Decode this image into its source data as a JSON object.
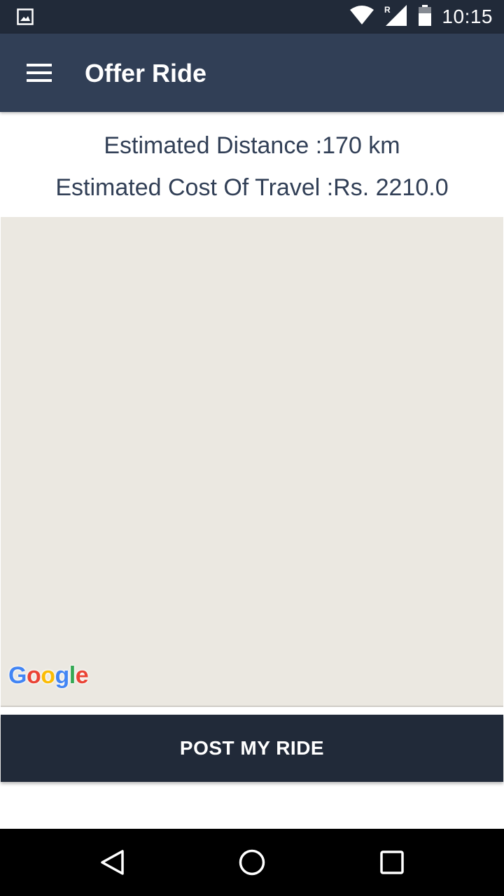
{
  "status_bar": {
    "time": "10:15",
    "icons": [
      "image-notification-icon",
      "wifi-icon",
      "signal-roaming-icon",
      "battery-icon"
    ],
    "roaming_indicator": "R"
  },
  "app_bar": {
    "title": "Offer Ride",
    "menu_icon": "hamburger-menu-icon",
    "background": "#313f56"
  },
  "estimate": {
    "distance_text": "Estimated Distance :170 km",
    "cost_text": "Estimated Cost Of Travel :Rs. 2210.0"
  },
  "map": {
    "attribution": "Google",
    "background": "#ebe8e1"
  },
  "actions": {
    "post_label": "POST MY RIDE",
    "button_color": "#212a39"
  },
  "nav_bar": {
    "icons": [
      "back-icon",
      "home-icon",
      "recents-icon"
    ]
  }
}
